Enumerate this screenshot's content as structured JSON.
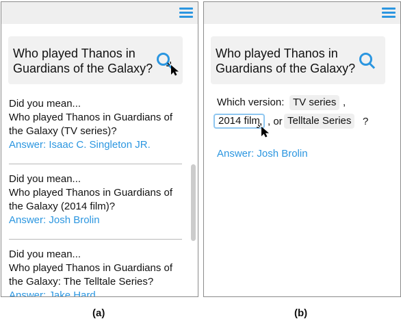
{
  "panel_a": {
    "query": "Who played Thanos in Guardians of the Galaxy?",
    "results": [
      {
        "prompt": "Did you mean...",
        "question": "Who played Thanos in Guardians of the Galaxy (TV series)?",
        "answer": "Answer: Isaac C. Singleton JR."
      },
      {
        "prompt": "Did you mean...",
        "question": "Who played Thanos in Guardians of the Galaxy (2014 film)?",
        "answer": "Answer: Josh Brolin"
      },
      {
        "prompt": "Did you mean...",
        "question": "Who played Thanos in Guardians of the Galaxy: The Telltale Series?",
        "answer": "Answer: Jake Hard"
      }
    ],
    "caption": "(a)"
  },
  "panel_b": {
    "query": "Who played Thanos in Guardians of the Galaxy?",
    "prompt": "Which version:",
    "options": [
      "TV series",
      "2014 film",
      "Telltale Series"
    ],
    "selected_option": "2014 film",
    "comma": ",",
    "or_text": ", or",
    "question_mark": "?",
    "answer": "Answer: Josh Brolin",
    "caption": "(b)"
  },
  "colors": {
    "accent": "#2b96e0",
    "topbar": "#efefef",
    "chip": "#efefef",
    "selected_border": "#8ec6f0"
  },
  "icons": [
    "menu-icon",
    "search-icon",
    "cursor-icon"
  ]
}
